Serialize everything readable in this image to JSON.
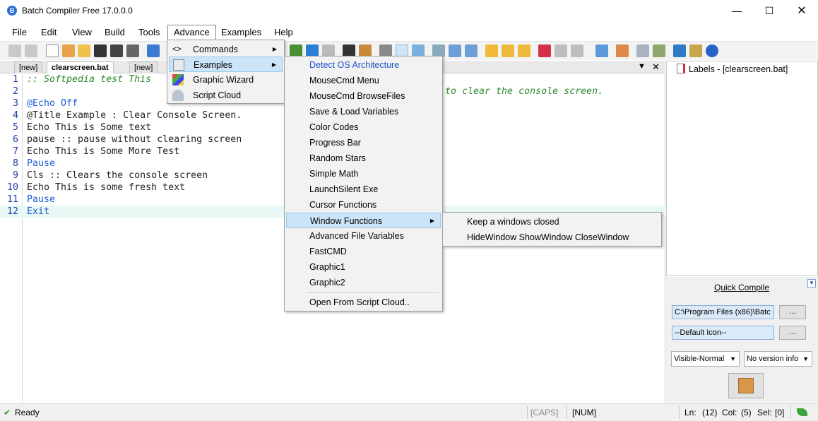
{
  "window": {
    "title": "Batch Compiler Free  17.0.0.0",
    "min_glyph": "—",
    "max_glyph": "☐",
    "close_glyph": "✕"
  },
  "menubar": {
    "items": [
      "File",
      "Edit",
      "View",
      "Build",
      "Tools",
      "Advance",
      "Examples",
      "Help"
    ],
    "active": "Advance"
  },
  "tabs": {
    "items": [
      "[new]",
      "clearscreen.bat",
      "[new]"
    ],
    "active": "clearscreen.bat",
    "dropdown_glyph": "▼",
    "close_glyph": "✕"
  },
  "editor": {
    "lines": [
      {
        "n": "1",
        "text": ":: Softpedia test This",
        "kind": "comment"
      },
      {
        "n": "2",
        "text": "",
        "kind": "text"
      },
      {
        "n": "3",
        "text": "@Echo Off",
        "kind": "kw"
      },
      {
        "n": "4",
        "text": "@Title Example : Clear Console Screen.",
        "kind": "mixed"
      },
      {
        "n": "5",
        "text": "Echo This is Some text",
        "kind": "mixed"
      },
      {
        "n": "6",
        "text": "pause :: pause without clearing screen",
        "kind": "mixed"
      },
      {
        "n": "7",
        "text": "Echo This is Some More Test",
        "kind": "mixed"
      },
      {
        "n": "8",
        "text": "Pause",
        "kind": "kw"
      },
      {
        "n": "9",
        "text": "Cls :: Clears the console screen",
        "kind": "mixed"
      },
      {
        "n": "10",
        "text": "Echo This is some fresh text",
        "kind": "mixed"
      },
      {
        "n": "11",
        "text": "Pause",
        "kind": "kw"
      },
      {
        "n": "12",
        "text": "Exit",
        "kind": "kw"
      }
    ],
    "hidden_tail_line1": "to clear the console screen.",
    "current_line": 12
  },
  "right_panel": {
    "labels_node": "Labels - [clearscreen.bat]",
    "quick_compile_title": "Quick Compile",
    "path_value": "C:\\Program Files (x86)\\Batc",
    "icon_value": "--Default Icon--",
    "browse_label": "...",
    "visibility_select": "Visible-Normal",
    "version_select": "No version info"
  },
  "advance_menu": {
    "items": [
      "Commands",
      "Examples",
      "Graphic Wizard",
      "Script Cloud"
    ],
    "highlighted": "Examples"
  },
  "examples_menu": {
    "items": [
      "Detect OS Architecture",
      "MouseCmd Menu",
      "MouseCmd BrowseFiles",
      "Save & Load Variables",
      "Color Codes",
      "Progress Bar",
      "Random Stars",
      "Simple Math",
      "LaunchSilent Exe",
      "Cursor Functions",
      "Window Functions",
      "Advanced File Variables",
      "FastCMD",
      "Graphic1",
      "Graphic2"
    ],
    "footer": "Open From Script Cloud..",
    "highlighted": "Window Functions"
  },
  "window_functions_menu": {
    "items": [
      "Keep a windows closed",
      "HideWindow ShowWindow CloseWindow"
    ]
  },
  "statusbar": {
    "ready": "Ready",
    "caps": "[CAPS]",
    "num": "[NUM]",
    "ln_label": "Ln:",
    "ln_value": "(12)",
    "col_label": "Col:",
    "col_value": "(5)",
    "sel_label": "Sel:",
    "sel_value": "[0]"
  },
  "colors": {
    "comment": "#2e8b2e",
    "keyword": "#1d5ad6",
    "line_number": "#1e3fa8",
    "highlight": "#cce4f7",
    "current_line": "#e8f8f4"
  }
}
